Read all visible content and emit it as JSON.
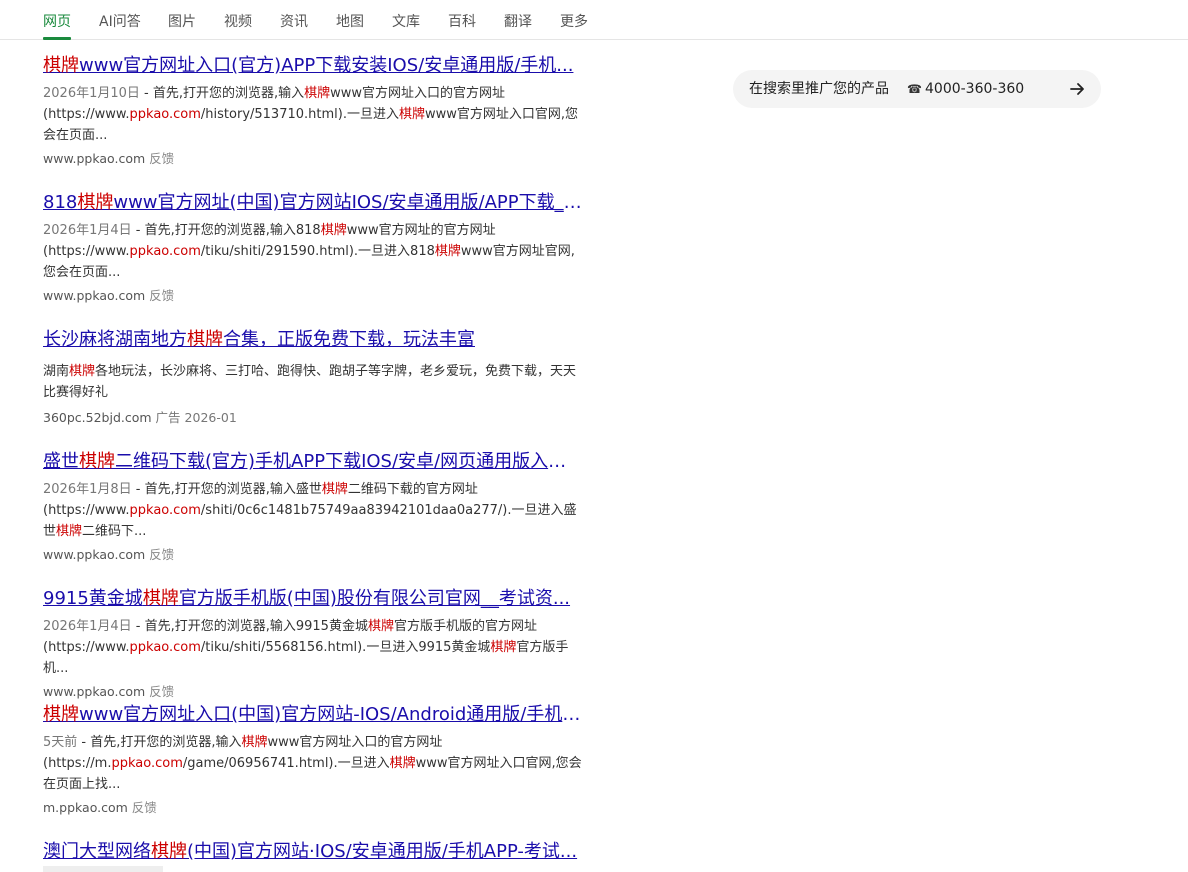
{
  "nav": {
    "tabs": [
      "网页",
      "AI问答",
      "图片",
      "视频",
      "资讯",
      "地图",
      "文库",
      "百科",
      "翻译",
      "更多"
    ],
    "active_index": 0
  },
  "results": [
    {
      "title_parts": [
        {
          "t": "棋牌",
          "hl": true
        },
        {
          "t": "www官方网址入口(官方)APP下载安装IOS/安卓通用版/手机...",
          "hl": false
        }
      ],
      "date": "2026年1月10日",
      "snippet_parts": [
        {
          "t": " - 首先,打开您的浏览器,输入",
          "c": "n"
        },
        {
          "t": "棋牌",
          "c": "h"
        },
        {
          "t": "www官方网址入口的官方网址(https://www.",
          "c": "n"
        },
        {
          "t": "ppkao.com",
          "c": "h"
        },
        {
          "t": "/history/513710.html).一旦进入",
          "c": "n"
        },
        {
          "t": "棋牌",
          "c": "h"
        },
        {
          "t": "www官方网址入口官网,您会在页面...",
          "c": "n"
        }
      ],
      "site": "www.ppkao.com",
      "feedback": "反馈"
    },
    {
      "title_parts": [
        {
          "t": "818",
          "hl": false
        },
        {
          "t": "棋牌",
          "hl": true
        },
        {
          "t": "www官方网址(中国)官方网站IOS/安卓通用版/APP下载__...",
          "hl": false
        }
      ],
      "date": "2026年1月4日",
      "snippet_parts": [
        {
          "t": " - 首先,打开您的浏览器,输入818",
          "c": "n"
        },
        {
          "t": "棋牌",
          "c": "h"
        },
        {
          "t": "www官方网址的官方网址(https://www.",
          "c": "n"
        },
        {
          "t": "ppkao.com",
          "c": "h"
        },
        {
          "t": "/tiku/shiti/291590.html).一旦进入818",
          "c": "n"
        },
        {
          "t": "棋牌",
          "c": "h"
        },
        {
          "t": "www官方网址官网,您会在页面...",
          "c": "n"
        }
      ],
      "site": "www.ppkao.com",
      "feedback": "反馈"
    },
    {
      "title_parts": [
        {
          "t": "长沙麻将湖南地方",
          "hl": false
        },
        {
          "t": "棋牌",
          "hl": true
        },
        {
          "t": "合集，正版免费下载，玩法丰富",
          "hl": false
        }
      ],
      "date": "",
      "snippet_parts": [
        {
          "t": "湖南",
          "c": "n"
        },
        {
          "t": "棋牌",
          "c": "h"
        },
        {
          "t": "各地玩法，长沙麻将、三打哈、跑得快、跑胡子等字牌，老乡爱玩，免费下载，天天比赛得好礼",
          "c": "n"
        }
      ],
      "site": "360pc.52bjd.com",
      "ad_label": "广告",
      "ad_date": "2026-01"
    },
    {
      "title_parts": [
        {
          "t": "盛世",
          "hl": false
        },
        {
          "t": "棋牌",
          "hl": true
        },
        {
          "t": "二维码下载(官方)手机APP下载IOS/安卓/网页通用版入口...",
          "hl": false
        }
      ],
      "date": "2026年1月8日",
      "snippet_parts": [
        {
          "t": " - 首先,打开您的浏览器,输入盛世",
          "c": "n"
        },
        {
          "t": "棋牌",
          "c": "h"
        },
        {
          "t": "二维码下载的官方网址(https://www.",
          "c": "n"
        },
        {
          "t": "ppkao.com",
          "c": "h"
        },
        {
          "t": "/shiti/0c6c1481b75749aa83942101daa0a277/).一旦进入盛世",
          "c": "n"
        },
        {
          "t": "棋牌",
          "c": "h"
        },
        {
          "t": "二维码下...",
          "c": "n"
        }
      ],
      "site": "www.ppkao.com",
      "feedback": "反馈"
    },
    {
      "title_parts": [
        {
          "t": "9915黄金城",
          "hl": false
        },
        {
          "t": "棋牌",
          "hl": true
        },
        {
          "t": "官方版手机版(中国)股份有限公司官网__考试资...",
          "hl": false
        }
      ],
      "date": "2026年1月4日",
      "snippet_parts": [
        {
          "t": " - 首先,打开您的浏览器,输入9915黄金城",
          "c": "n"
        },
        {
          "t": "棋牌",
          "c": "h"
        },
        {
          "t": "官方版手机版的官方网址(https://www.",
          "c": "n"
        },
        {
          "t": "ppkao.com",
          "c": "h"
        },
        {
          "t": "/tiku/shiti/5568156.html).一旦进入9915黄金城",
          "c": "n"
        },
        {
          "t": "棋牌",
          "c": "h"
        },
        {
          "t": "官方版手机...",
          "c": "n"
        }
      ],
      "site": "www.ppkao.com",
      "feedback": "反馈"
    },
    {
      "title_parts": [
        {
          "t": "棋牌",
          "hl": true
        },
        {
          "t": "www官方网址入口(中国)官方网站-IOS/Android通用版/手机A...",
          "hl": false
        }
      ],
      "date": "5天前",
      "snippet_parts": [
        {
          "t": " - 首先,打开您的浏览器,输入",
          "c": "n"
        },
        {
          "t": "棋牌",
          "c": "h"
        },
        {
          "t": "www官方网址入口的官方网址(https://m.",
          "c": "n"
        },
        {
          "t": "ppkao.com",
          "c": "h"
        },
        {
          "t": "/game/06956741.html).一旦进入",
          "c": "n"
        },
        {
          "t": "棋牌",
          "c": "h"
        },
        {
          "t": "www官方网址入口官网,您会在页面上找...",
          "c": "n"
        }
      ],
      "site": "m.ppkao.com",
      "feedback": "反馈"
    },
    {
      "title_parts": [
        {
          "t": "澳门大型网络",
          "hl": false
        },
        {
          "t": "棋牌",
          "hl": true
        },
        {
          "t": "(中国)官方网站·IOS/安卓通用版/手机APP-考试...",
          "hl": false
        }
      ],
      "date": "",
      "snippet_parts": [],
      "site": "",
      "feedback": ""
    }
  ],
  "promo": {
    "text": "在搜索里推广您的产品",
    "phone": "4000-360-360",
    "phone_icon": "phone-icon",
    "arrow_icon": "arrow-right-icon"
  },
  "colors": {
    "accent": "#1a8a3d",
    "link": "#1a0dab",
    "highlight": "#cc0000"
  }
}
